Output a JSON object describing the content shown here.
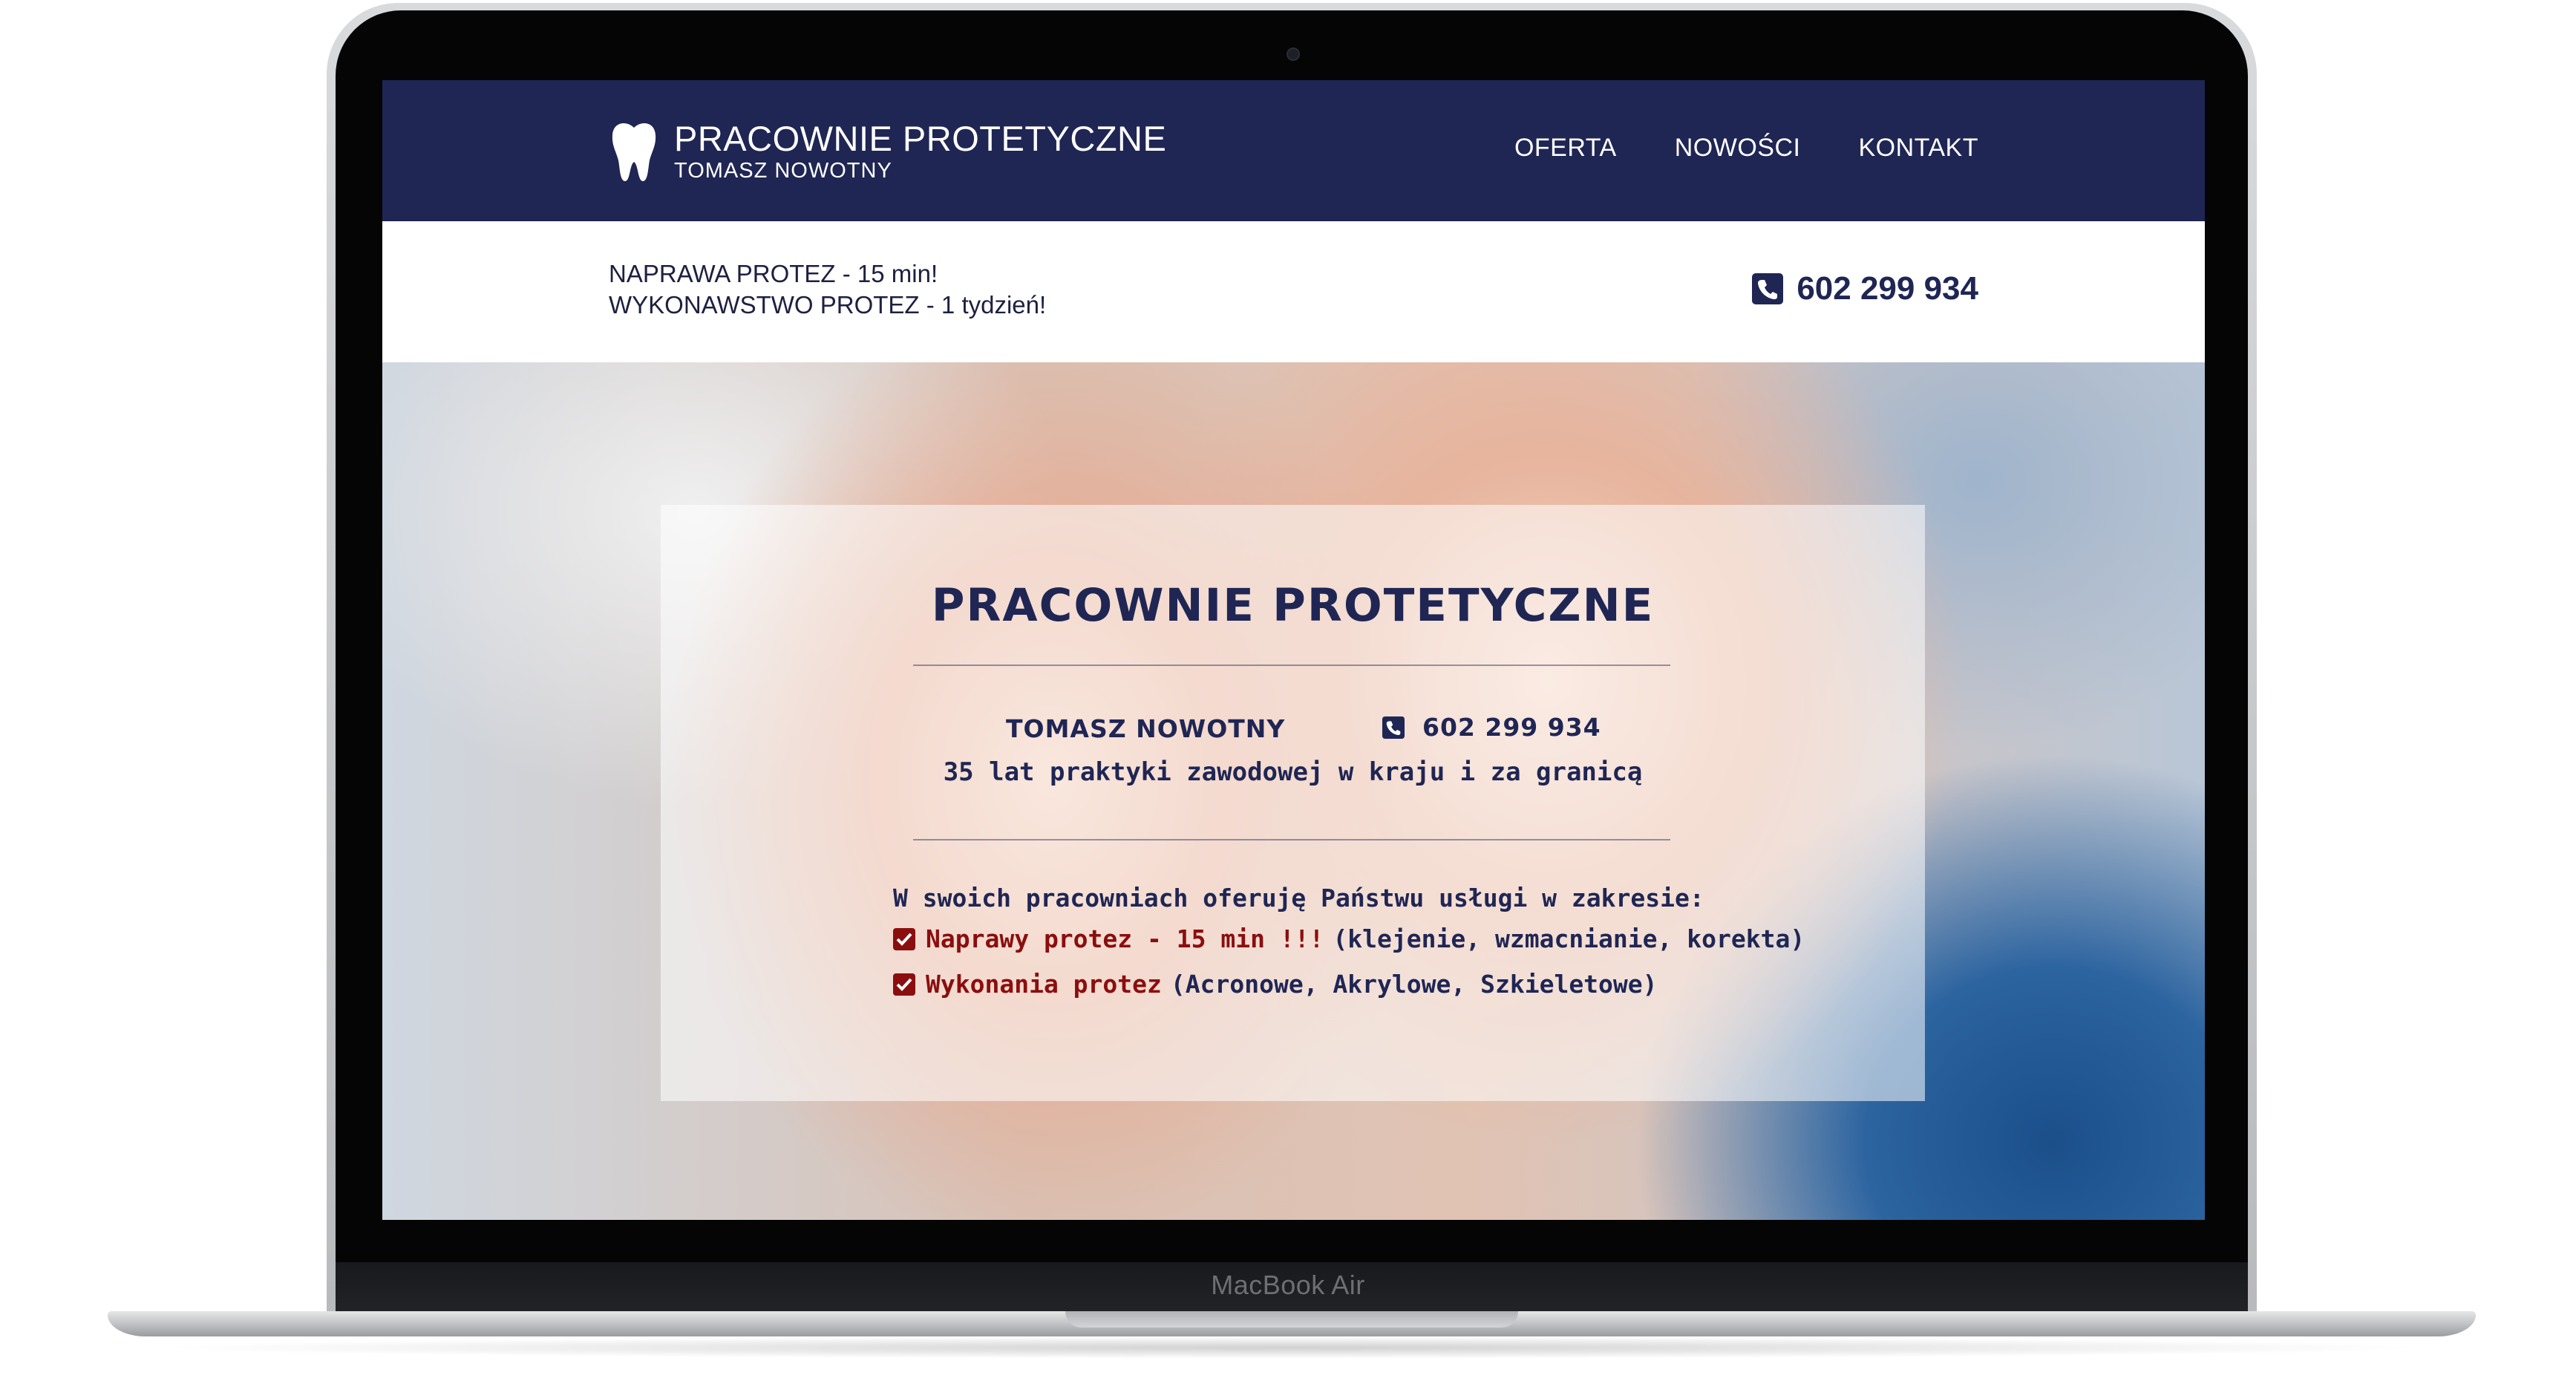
{
  "device": {
    "label": "MacBook Air"
  },
  "header": {
    "brand_title": "PRACOWNIE PROTETYCZNE",
    "brand_subtitle": "TOMASZ NOWOTNY",
    "nav": [
      "OFERTA",
      "NOWOŚCI",
      "KONTAKT"
    ]
  },
  "infobar": {
    "promo_line1": "NAPRAWA PROTEZ - 15 min!",
    "promo_line2": "WYKONAWSTWO PROTEZ - 1 tydzień!",
    "phone": "602 299 934"
  },
  "hero": {
    "title": "PRACOWNIE PROTETYCZNE",
    "owner": "TOMASZ NOWOTNY",
    "phone": "602 299 934",
    "experience": "35 lat praktyki zawodowej w kraju i za granicą",
    "services_intro": "W swoich pracowniach oferuję Państwu usługi w zakresie:",
    "services": [
      {
        "highlight": "Naprawy protez - 15 min !!!",
        "detail": "(klejenie, wzmacnianie, korekta)"
      },
      {
        "highlight": "Wykonania protez",
        "detail": "(Acronowe, Akrylowe, Szkieletowe)"
      }
    ]
  },
  "colors": {
    "navy": "#1f2654",
    "accent_red": "#8b0e0e",
    "white": "#ffffff"
  },
  "icons": [
    "tooth-icon",
    "phone-icon",
    "check-icon"
  ]
}
